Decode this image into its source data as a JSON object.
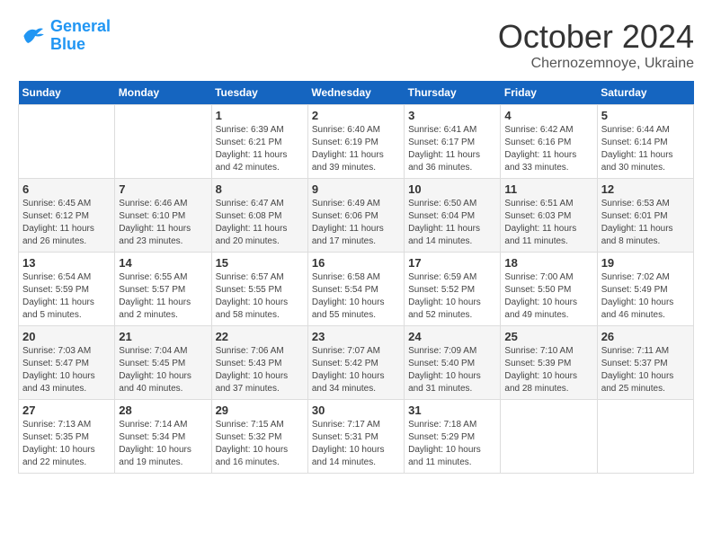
{
  "header": {
    "logo_line1": "General",
    "logo_line2": "Blue",
    "month": "October 2024",
    "location": "Chernozemnoye, Ukraine"
  },
  "weekdays": [
    "Sunday",
    "Monday",
    "Tuesday",
    "Wednesday",
    "Thursday",
    "Friday",
    "Saturday"
  ],
  "weeks": [
    [
      {
        "day": "",
        "sunrise": "",
        "sunset": "",
        "daylight": ""
      },
      {
        "day": "",
        "sunrise": "",
        "sunset": "",
        "daylight": ""
      },
      {
        "day": "1",
        "sunrise": "Sunrise: 6:39 AM",
        "sunset": "Sunset: 6:21 PM",
        "daylight": "Daylight: 11 hours and 42 minutes."
      },
      {
        "day": "2",
        "sunrise": "Sunrise: 6:40 AM",
        "sunset": "Sunset: 6:19 PM",
        "daylight": "Daylight: 11 hours and 39 minutes."
      },
      {
        "day": "3",
        "sunrise": "Sunrise: 6:41 AM",
        "sunset": "Sunset: 6:17 PM",
        "daylight": "Daylight: 11 hours and 36 minutes."
      },
      {
        "day": "4",
        "sunrise": "Sunrise: 6:42 AM",
        "sunset": "Sunset: 6:16 PM",
        "daylight": "Daylight: 11 hours and 33 minutes."
      },
      {
        "day": "5",
        "sunrise": "Sunrise: 6:44 AM",
        "sunset": "Sunset: 6:14 PM",
        "daylight": "Daylight: 11 hours and 30 minutes."
      }
    ],
    [
      {
        "day": "6",
        "sunrise": "Sunrise: 6:45 AM",
        "sunset": "Sunset: 6:12 PM",
        "daylight": "Daylight: 11 hours and 26 minutes."
      },
      {
        "day": "7",
        "sunrise": "Sunrise: 6:46 AM",
        "sunset": "Sunset: 6:10 PM",
        "daylight": "Daylight: 11 hours and 23 minutes."
      },
      {
        "day": "8",
        "sunrise": "Sunrise: 6:47 AM",
        "sunset": "Sunset: 6:08 PM",
        "daylight": "Daylight: 11 hours and 20 minutes."
      },
      {
        "day": "9",
        "sunrise": "Sunrise: 6:49 AM",
        "sunset": "Sunset: 6:06 PM",
        "daylight": "Daylight: 11 hours and 17 minutes."
      },
      {
        "day": "10",
        "sunrise": "Sunrise: 6:50 AM",
        "sunset": "Sunset: 6:04 PM",
        "daylight": "Daylight: 11 hours and 14 minutes."
      },
      {
        "day": "11",
        "sunrise": "Sunrise: 6:51 AM",
        "sunset": "Sunset: 6:03 PM",
        "daylight": "Daylight: 11 hours and 11 minutes."
      },
      {
        "day": "12",
        "sunrise": "Sunrise: 6:53 AM",
        "sunset": "Sunset: 6:01 PM",
        "daylight": "Daylight: 11 hours and 8 minutes."
      }
    ],
    [
      {
        "day": "13",
        "sunrise": "Sunrise: 6:54 AM",
        "sunset": "Sunset: 5:59 PM",
        "daylight": "Daylight: 11 hours and 5 minutes."
      },
      {
        "day": "14",
        "sunrise": "Sunrise: 6:55 AM",
        "sunset": "Sunset: 5:57 PM",
        "daylight": "Daylight: 11 hours and 2 minutes."
      },
      {
        "day": "15",
        "sunrise": "Sunrise: 6:57 AM",
        "sunset": "Sunset: 5:55 PM",
        "daylight": "Daylight: 10 hours and 58 minutes."
      },
      {
        "day": "16",
        "sunrise": "Sunrise: 6:58 AM",
        "sunset": "Sunset: 5:54 PM",
        "daylight": "Daylight: 10 hours and 55 minutes."
      },
      {
        "day": "17",
        "sunrise": "Sunrise: 6:59 AM",
        "sunset": "Sunset: 5:52 PM",
        "daylight": "Daylight: 10 hours and 52 minutes."
      },
      {
        "day": "18",
        "sunrise": "Sunrise: 7:00 AM",
        "sunset": "Sunset: 5:50 PM",
        "daylight": "Daylight: 10 hours and 49 minutes."
      },
      {
        "day": "19",
        "sunrise": "Sunrise: 7:02 AM",
        "sunset": "Sunset: 5:49 PM",
        "daylight": "Daylight: 10 hours and 46 minutes."
      }
    ],
    [
      {
        "day": "20",
        "sunrise": "Sunrise: 7:03 AM",
        "sunset": "Sunset: 5:47 PM",
        "daylight": "Daylight: 10 hours and 43 minutes."
      },
      {
        "day": "21",
        "sunrise": "Sunrise: 7:04 AM",
        "sunset": "Sunset: 5:45 PM",
        "daylight": "Daylight: 10 hours and 40 minutes."
      },
      {
        "day": "22",
        "sunrise": "Sunrise: 7:06 AM",
        "sunset": "Sunset: 5:43 PM",
        "daylight": "Daylight: 10 hours and 37 minutes."
      },
      {
        "day": "23",
        "sunrise": "Sunrise: 7:07 AM",
        "sunset": "Sunset: 5:42 PM",
        "daylight": "Daylight: 10 hours and 34 minutes."
      },
      {
        "day": "24",
        "sunrise": "Sunrise: 7:09 AM",
        "sunset": "Sunset: 5:40 PM",
        "daylight": "Daylight: 10 hours and 31 minutes."
      },
      {
        "day": "25",
        "sunrise": "Sunrise: 7:10 AM",
        "sunset": "Sunset: 5:39 PM",
        "daylight": "Daylight: 10 hours and 28 minutes."
      },
      {
        "day": "26",
        "sunrise": "Sunrise: 7:11 AM",
        "sunset": "Sunset: 5:37 PM",
        "daylight": "Daylight: 10 hours and 25 minutes."
      }
    ],
    [
      {
        "day": "27",
        "sunrise": "Sunrise: 7:13 AM",
        "sunset": "Sunset: 5:35 PM",
        "daylight": "Daylight: 10 hours and 22 minutes."
      },
      {
        "day": "28",
        "sunrise": "Sunrise: 7:14 AM",
        "sunset": "Sunset: 5:34 PM",
        "daylight": "Daylight: 10 hours and 19 minutes."
      },
      {
        "day": "29",
        "sunrise": "Sunrise: 7:15 AM",
        "sunset": "Sunset: 5:32 PM",
        "daylight": "Daylight: 10 hours and 16 minutes."
      },
      {
        "day": "30",
        "sunrise": "Sunrise: 7:17 AM",
        "sunset": "Sunset: 5:31 PM",
        "daylight": "Daylight: 10 hours and 14 minutes."
      },
      {
        "day": "31",
        "sunrise": "Sunrise: 7:18 AM",
        "sunset": "Sunset: 5:29 PM",
        "daylight": "Daylight: 10 hours and 11 minutes."
      },
      {
        "day": "",
        "sunrise": "",
        "sunset": "",
        "daylight": ""
      },
      {
        "day": "",
        "sunrise": "",
        "sunset": "",
        "daylight": ""
      }
    ]
  ]
}
